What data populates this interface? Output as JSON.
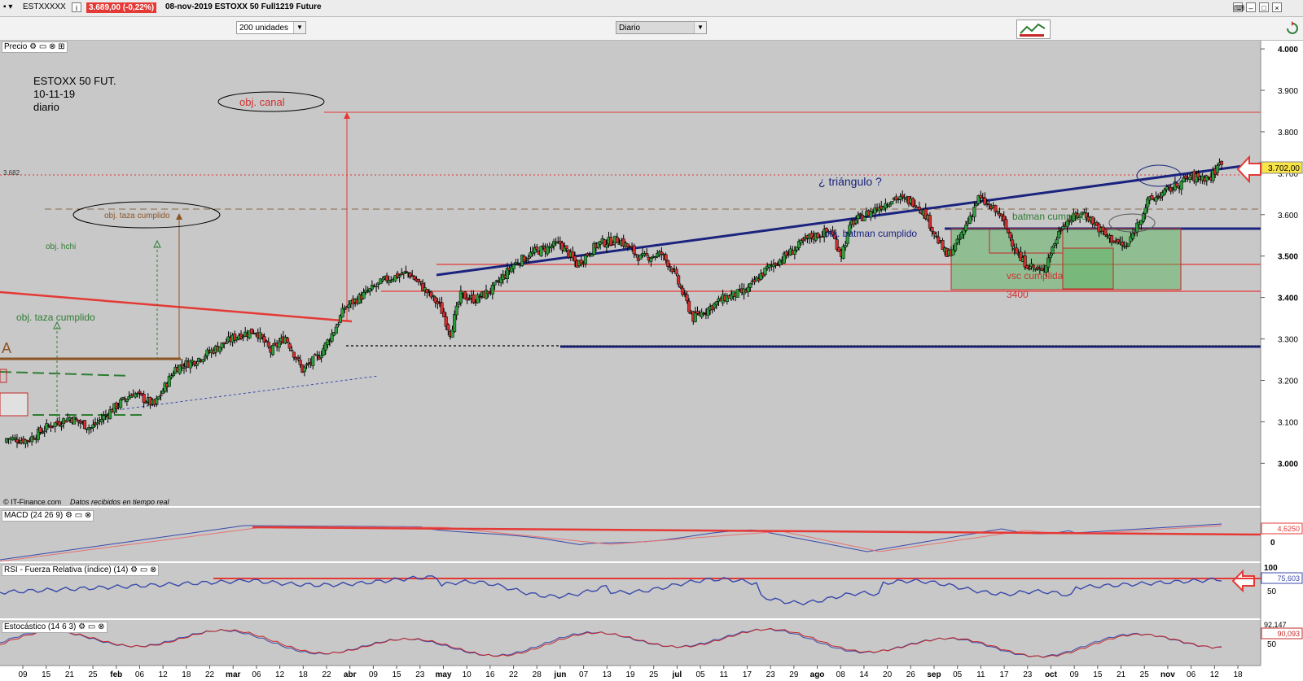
{
  "window": {
    "symbol": "ESTXXXXX",
    "price_change": "3.689,00 (-0,22%)",
    "description": "08-nov-2019 ESTOXX 50 Full1219 Future",
    "units_select": "200 unidades",
    "period_select": "Diario"
  },
  "panels": {
    "price_label": "Precio",
    "macd_label": "MACD (24 26 9)",
    "rsi_label": "RSI - Fuerza Relativa (índice) (14)",
    "stoch_label": "Estocástico (14 6 3)",
    "credit_source": "© IT-Finance.com",
    "credit_note": "Datos recibidos en tiempo real"
  },
  "chart_data": [
    {
      "type": "candlestick",
      "title": "ESTOXX 50 FUT.",
      "subtitle_date": "10-11-19",
      "subtitle_period": "diario",
      "y_ticks": [
        "4.000",
        "3.900",
        "3.800",
        "3.700",
        "3.600",
        "3.500",
        "3.400",
        "3.300",
        "3.200",
        "3.100",
        "3.000"
      ],
      "ylim": [
        2930,
        4010
      ],
      "last_price_tag": "3.702,00",
      "ref_level_label": "3.682",
      "x_ticks": [
        "09",
        "15",
        "21",
        "25",
        "feb",
        "06",
        "12",
        "18",
        "22",
        "mar",
        "06",
        "12",
        "18",
        "22",
        "abr",
        "09",
        "15",
        "23",
        "may",
        "10",
        "16",
        "22",
        "28",
        "jun",
        "07",
        "13",
        "19",
        "25",
        "jul",
        "05",
        "11",
        "17",
        "23",
        "29",
        "ago",
        "08",
        "14",
        "20",
        "26",
        "sep",
        "05",
        "11",
        "17",
        "23",
        "oct",
        "09",
        "15",
        "21",
        "25",
        "nov",
        "06",
        "12",
        "18"
      ],
      "close_path": [
        [
          0,
          3060
        ],
        [
          10,
          3055
        ],
        [
          20,
          3090
        ],
        [
          30,
          3110
        ],
        [
          40,
          3085
        ],
        [
          50,
          3130
        ],
        [
          60,
          3170
        ],
        [
          70,
          3140
        ],
        [
          80,
          3230
        ],
        [
          90,
          3250
        ],
        [
          100,
          3280
        ],
        [
          110,
          3310
        ],
        [
          118,
          3320
        ],
        [
          125,
          3270
        ],
        [
          132,
          3305
        ],
        [
          140,
          3225
        ],
        [
          148,
          3260
        ],
        [
          155,
          3320
        ],
        [
          160,
          3375
        ],
        [
          170,
          3410
        ],
        [
          180,
          3445
        ],
        [
          190,
          3460
        ],
        [
          195,
          3435
        ],
        [
          205,
          3380
        ],
        [
          210,
          3315
        ],
        [
          215,
          3405
        ],
        [
          222,
          3395
        ],
        [
          230,
          3420
        ],
        [
          240,
          3480
        ],
        [
          250,
          3510
        ],
        [
          262,
          3530
        ],
        [
          270,
          3480
        ],
        [
          280,
          3530
        ],
        [
          290,
          3540
        ],
        [
          300,
          3495
        ],
        [
          310,
          3505
        ],
        [
          315,
          3470
        ],
        [
          325,
          3350
        ],
        [
          340,
          3400
        ],
        [
          350,
          3415
        ],
        [
          360,
          3470
        ],
        [
          370,
          3505
        ],
        [
          380,
          3545
        ],
        [
          390,
          3560
        ],
        [
          395,
          3505
        ],
        [
          400,
          3580
        ],
        [
          410,
          3610
        ],
        [
          420,
          3640
        ],
        [
          430,
          3630
        ],
        [
          435,
          3600
        ],
        [
          440,
          3545
        ],
        [
          445,
          3500
        ],
        [
          450,
          3530
        ],
        [
          460,
          3640
        ],
        [
          470,
          3600
        ],
        [
          480,
          3490
        ],
        [
          490,
          3460
        ],
        [
          500,
          3580
        ],
        [
          510,
          3605
        ],
        [
          520,
          3550
        ],
        [
          530,
          3520
        ],
        [
          540,
          3630
        ],
        [
          550,
          3660
        ],
        [
          560,
          3690
        ],
        [
          570,
          3690
        ],
        [
          575,
          3730
        ]
      ],
      "annotations": [
        {
          "text": "obj. canal"
        },
        {
          "text": "obj. taza cumplido"
        },
        {
          "text": "obj. hchi"
        },
        {
          "text": "obj. taza cumplido"
        },
        {
          "text": "¿ triángulo  ?"
        },
        {
          "text": "obj. batman cumplido"
        },
        {
          "text": "batman  cumplido"
        },
        {
          "text": "vsc cumplida"
        },
        {
          "text": "3400"
        }
      ]
    },
    {
      "type": "line",
      "title": "MACD (24 26 9)",
      "y_ticks": [
        "0"
      ],
      "last_value_tag": "4,6250"
    },
    {
      "type": "line",
      "title": "RSI - Fuerza Relativa (índice) (14)",
      "y_ticks": [
        "100",
        "50"
      ],
      "last_value_tag": "75,603"
    },
    {
      "type": "line",
      "title": "Estocástico (14 6 3)",
      "y_ticks": [
        "50"
      ],
      "last_value_tag": "90,093",
      "top_value_tag": "92,147"
    }
  ]
}
